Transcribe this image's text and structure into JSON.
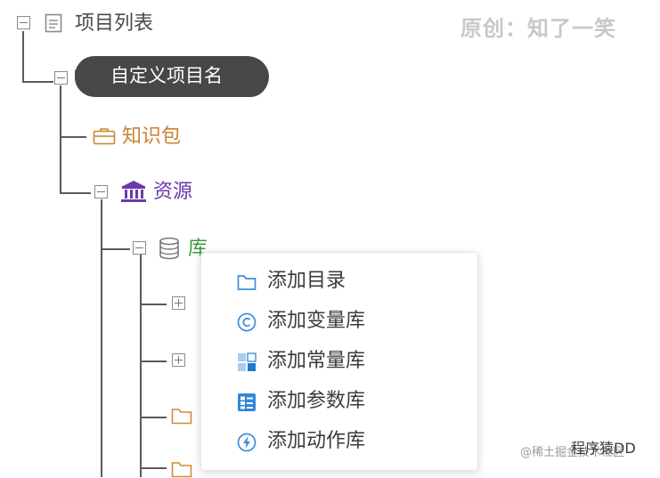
{
  "watermark": "原创：知了一笑",
  "tree": {
    "root_label": "项目列表",
    "custom_project_label": "自定义项目名",
    "knowledge_pack_label": "知识包",
    "resources_label": "资源",
    "library_label": "库"
  },
  "context_menu": {
    "items": [
      {
        "label": "添加目录",
        "icon": "folder-icon"
      },
      {
        "label": "添加变量库",
        "icon": "variable-c-icon"
      },
      {
        "label": "添加常量库",
        "icon": "constant-grid-icon"
      },
      {
        "label": "添加参数库",
        "icon": "parameter-list-icon"
      },
      {
        "label": "添加动作库",
        "icon": "action-bolt-icon"
      }
    ]
  },
  "footer_watermark": {
    "account": "程序猿DD",
    "handle": "@稀土掘金技术社区"
  },
  "colors": {
    "line": "#5a5a5a",
    "knowledge_pack": "#c9832f",
    "resources": "#6a3aa8",
    "library": "#3a9a3a",
    "menu_icon": "#3b8ede"
  }
}
